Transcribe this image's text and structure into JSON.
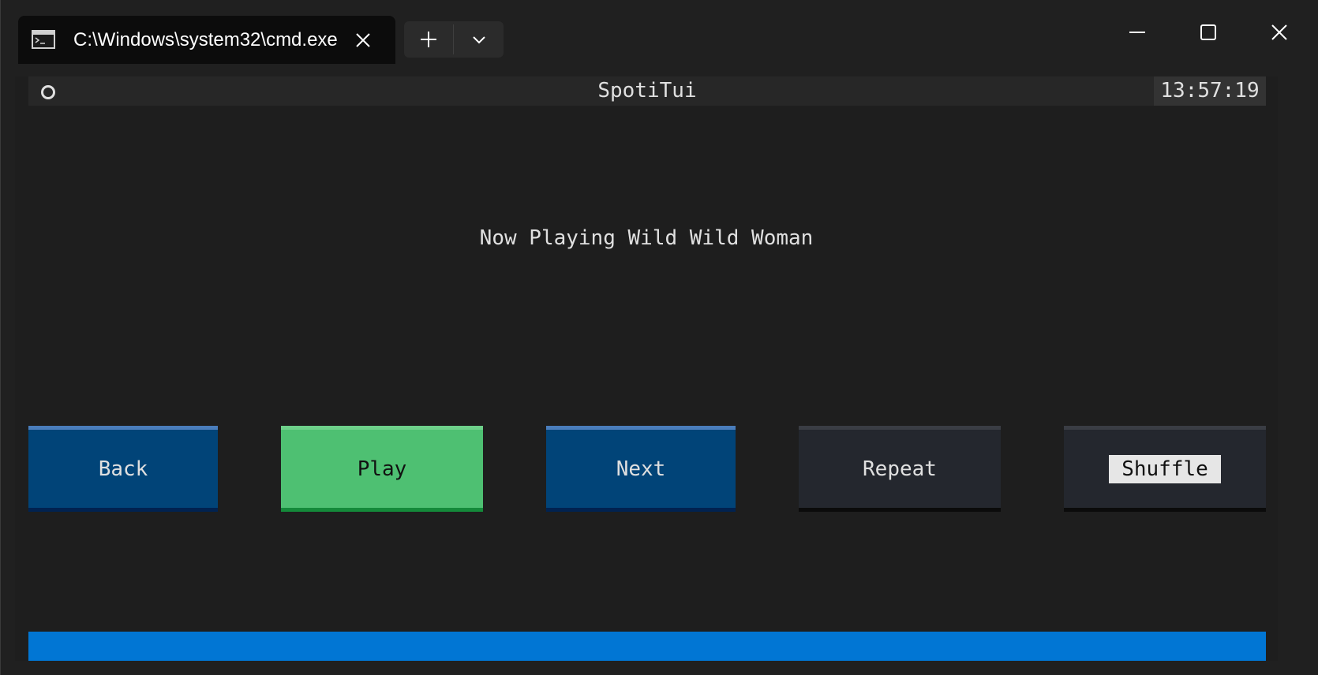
{
  "window": {
    "tab_title": "C:\\Windows\\system32\\cmd.exe",
    "icons": {
      "tab": "cmd-icon",
      "close_tab": "close-icon",
      "new_tab": "plus-icon",
      "dropdown": "chevron-down-icon",
      "minimize": "minimize-icon",
      "maximize": "maximize-icon",
      "close": "close-icon"
    }
  },
  "app": {
    "title": "SpotiTui",
    "clock": "13:57:19",
    "now_playing": "Now Playing Wild Wild Woman",
    "buttons": [
      {
        "label": "Back",
        "variant": "primary"
      },
      {
        "label": "Play",
        "variant": "success"
      },
      {
        "label": "Next",
        "variant": "primary"
      },
      {
        "label": "Repeat",
        "variant": "default"
      },
      {
        "label": "Shuffle",
        "variant": "default",
        "focused": true
      }
    ],
    "progress": 1.0
  },
  "colors": {
    "terminal_bg": "#1e1e1e",
    "primary": "#014478",
    "success": "#4ec072",
    "default": "#24272e",
    "progress": "#0176d4"
  }
}
